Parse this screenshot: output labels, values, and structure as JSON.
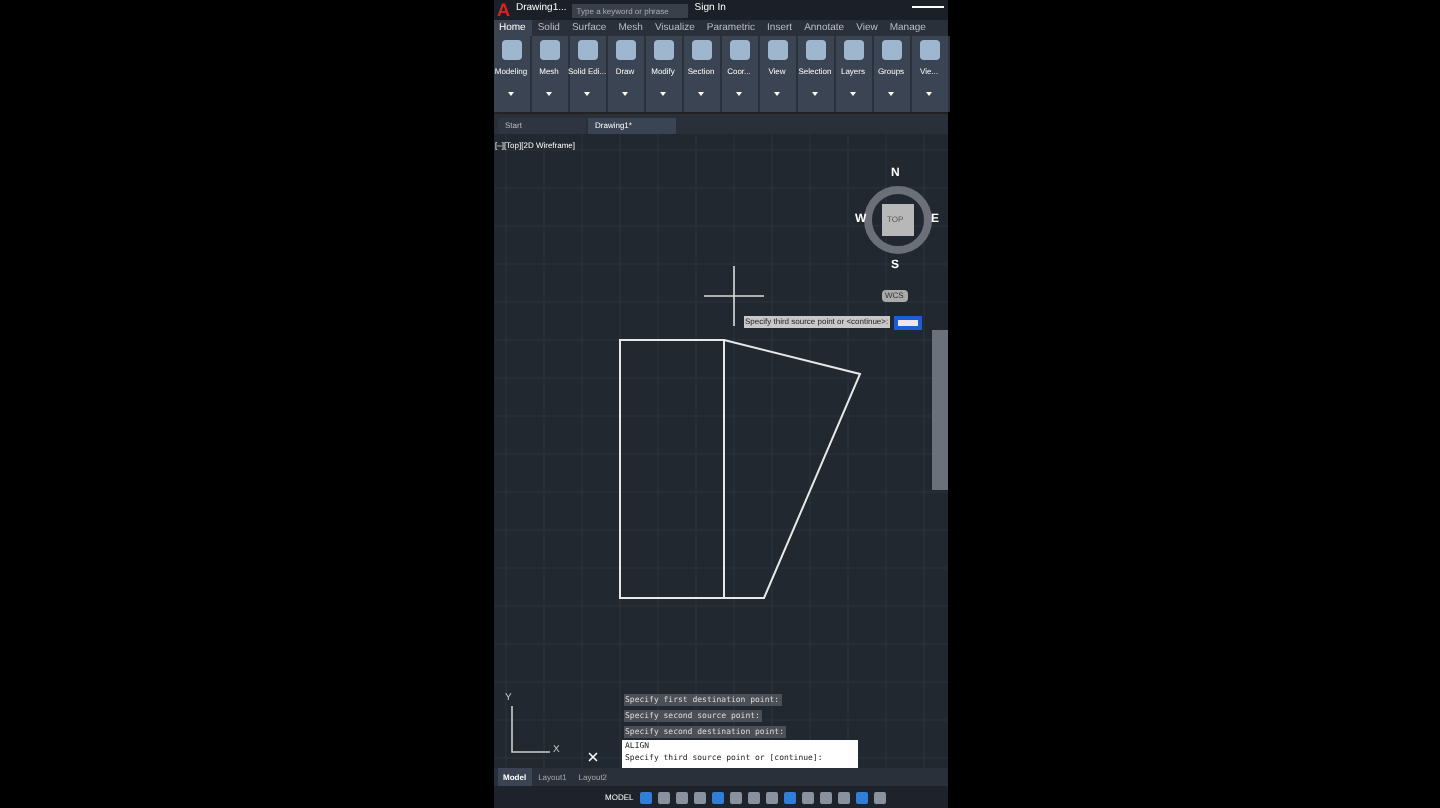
{
  "title_bar": {
    "logo": "A",
    "title": "Drawing1...",
    "search": {
      "placeholder": "Type a keyword or phrase"
    },
    "sign_in": "Sign In"
  },
  "ribbon_tabs": [
    {
      "label": "Home",
      "selected": true
    },
    {
      "label": "Solid",
      "selected": false
    },
    {
      "label": "Surface",
      "selected": false
    },
    {
      "label": "Mesh",
      "selected": false
    },
    {
      "label": "Visualize",
      "selected": false
    },
    {
      "label": "Parametric",
      "selected": false
    },
    {
      "label": "Insert",
      "selected": false
    },
    {
      "label": "Annotate",
      "selected": false
    },
    {
      "label": "View",
      "selected": false
    },
    {
      "label": "Manage",
      "selected": false
    }
  ],
  "ribbon_panels": [
    "Modeling",
    "Mesh",
    "Solid Edi...",
    "Draw",
    "Modify",
    "Section",
    "Coor...",
    "View",
    "Selection",
    "Layers",
    "Groups",
    "Vie..."
  ],
  "file_tabs": [
    {
      "label": "Start",
      "selected": false
    },
    {
      "label": "Drawing1*",
      "selected": true
    }
  ],
  "viewport": {
    "label": "[–][Top][2D Wireframe]",
    "viewcube": {
      "north": "N",
      "east": "E",
      "south": "S",
      "west": "W",
      "face": "TOP",
      "wcs": "WCS"
    },
    "tooltip": "Specify third source point or <continue>:",
    "command_history": [
      "Specify first destination point:",
      "Specify second source point:",
      "Specify second destination point:"
    ],
    "command": {
      "name": "ALIGN",
      "prompt": "Specify third source point or [continue]:"
    },
    "ucs": {
      "y": "Y",
      "x": "X"
    }
  },
  "layout_tabs": [
    {
      "label": "Model",
      "selected": true
    },
    {
      "label": "Layout1",
      "selected": false
    },
    {
      "label": "Layout2",
      "selected": false
    }
  ],
  "status_bar": {
    "mode": "MODEL"
  }
}
